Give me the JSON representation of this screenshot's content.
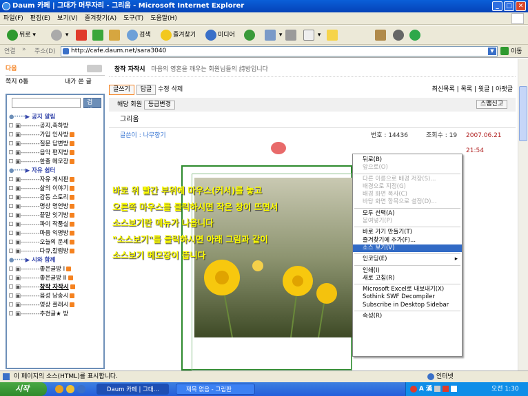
{
  "window": {
    "title": "Daum 카페 | 그대가 머무자리 - 그리움 - Microsoft Internet Explorer"
  },
  "menu": [
    "파일(F)",
    "편집(E)",
    "보기(V)",
    "즐겨찾기(A)",
    "도구(T)",
    "도움말(H)"
  ],
  "toolbar": {
    "back": "뒤로",
    "search": "검색",
    "favorites": "즐겨찾기",
    "media": "미디어"
  },
  "address": {
    "links_label": "연결",
    "label": "주소(D)",
    "url": "http://cafe.daum.net/sara3040",
    "go": "이동"
  },
  "sidebar": {
    "logo": "다음",
    "mail": "쪽지 0통",
    "mywrite": "내가 쓴 글",
    "search_button": "검색",
    "items": [
      {
        "label": "▶ 공지 알림",
        "category": true
      },
      {
        "label": "공지,축하방"
      },
      {
        "label": "가입 인사방",
        "new": true
      },
      {
        "label": "질문 답변방",
        "new": true
      },
      {
        "label": "음악 편지방",
        "new": true
      },
      {
        "label": "한줄 메모장",
        "new": true
      },
      {
        "label": "▶ 자유 쉼터",
        "category": true
      },
      {
        "label": "자유 게시판",
        "new": true
      },
      {
        "label": "삶의 이야기",
        "new": true
      },
      {
        "label": "감동 스토리",
        "new": true
      },
      {
        "label": "명상 명언방",
        "new": true
      },
      {
        "label": "끝말 잇기방",
        "new": true
      },
      {
        "label": "파이 작품실",
        "new": true
      },
      {
        "label": "마음 익명방",
        "new": true
      },
      {
        "label": "오늘의 운세",
        "new": true
      },
      {
        "label": "다큐,칼럼방",
        "new": true
      },
      {
        "label": "▶ 시와 함께",
        "category": true
      },
      {
        "label": "좋은글방 I",
        "new": true
      },
      {
        "label": "좋은글방 II",
        "new": true
      },
      {
        "label": "창작 자작시",
        "new": true
      },
      {
        "label": "음성 낭송시",
        "new": true
      },
      {
        "label": "영상 플래시",
        "new": true
      },
      {
        "label": "추천글★ 방"
      }
    ]
  },
  "main": {
    "board_title": "창작 자작시",
    "board_desc": "마음의 영혼을 깨우는 회원님들의 詩방입니다",
    "write": "글쓰기",
    "reply": "답글",
    "edit": "수정",
    "delete": "삭제",
    "nav": [
      "최신목록",
      "목록",
      "윗글",
      "아랫글"
    ],
    "member_label": "해당 회원",
    "level_change": "등급변경",
    "spam": "스팸신고",
    "post_title": "그리움",
    "author_label": "글쓴이 : 나무향기",
    "number": "번호 : 14436",
    "views": "조회수 : 19",
    "date": "2007.06.21 21:54"
  },
  "overlay_lines": [
    "바로 위 빨간 부위에 마우스(커서)를 놓고",
    "오른쪽 마우스를 클릭하시면 작은 창이 뜨면서",
    "소스보기란 메뉴가 나옵니다",
    "\"소스보기\"를 클릭하시면 아래 그림과 같이",
    "소스보기 메모장이 뜹니다"
  ],
  "context_menu": [
    {
      "label": "뒤로(B)"
    },
    {
      "label": "앞으로(O)",
      "disabled": true
    },
    {
      "sep": true
    },
    {
      "label": "다른 이름으로 배경 저장(S)...",
      "disabled": true
    },
    {
      "label": "배경으로 지정(G)",
      "disabled": true
    },
    {
      "label": "배경 화면 복사(C)",
      "disabled": true
    },
    {
      "label": "바탕 화면 항목으로 설정(D)...",
      "disabled": true
    },
    {
      "sep": true
    },
    {
      "label": "모두 선택(A)"
    },
    {
      "label": "붙여넣기(P)",
      "disabled": true
    },
    {
      "sep": true
    },
    {
      "label": "바로 가기 만들기(T)"
    },
    {
      "label": "즐겨찾기에 추가(F)..."
    },
    {
      "label": "소스 보기(V)",
      "selected": true
    },
    {
      "sep": true
    },
    {
      "label": "인코딩(E)",
      "submenu": true
    },
    {
      "sep": true
    },
    {
      "label": "인쇄(I)"
    },
    {
      "label": "새로 고침(R)"
    },
    {
      "sep": true
    },
    {
      "label": "Microsoft Excel로 내보내기(X)"
    },
    {
      "label": "Sothink SWF Decompiler"
    },
    {
      "label": "Subscribe in Desktop Sidebar"
    },
    {
      "sep": true
    },
    {
      "label": "속성(R)"
    }
  ],
  "status": {
    "text": "이 페이지의 소스(HTML)를 표시합니다.",
    "zone": "인터넷"
  },
  "taskbar": {
    "start": "시작",
    "tasks": [
      "Daum 카페 | 그대...",
      "제목 없음 - 그림판"
    ],
    "clock": "오전 1:30"
  }
}
